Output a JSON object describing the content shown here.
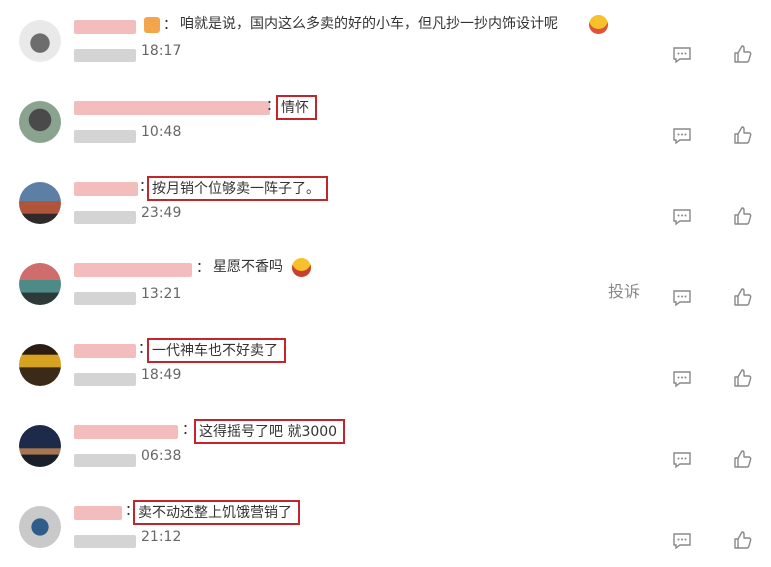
{
  "comments": [
    {
      "text": "咱就是说，国内这么多卖的好的小车，但凡抄一抄内饰设计呢",
      "time": "18:17",
      "boxed": false
    },
    {
      "text": "情怀",
      "time": "10:48",
      "boxed": true
    },
    {
      "text": "按月销个位够卖一阵子了。",
      "time": "23:49",
      "boxed": true
    },
    {
      "text": "星愿不香吗",
      "time": "13:21",
      "boxed": false
    },
    {
      "text": "一代神车也不好卖了",
      "time": "18:49",
      "boxed": true
    },
    {
      "text": "这得摇号了吧 就3000",
      "time": "06:38",
      "boxed": true
    },
    {
      "text": "卖不动还整上饥饿营销了",
      "time": "21:12",
      "boxed": true
    }
  ],
  "report_label": "投诉",
  "separator": "：",
  "icons": {
    "reply": "comment-reply-icon",
    "like": "thumbs-up-icon"
  },
  "colors": {
    "highlight_box": "#c0272d",
    "username_blur": "#f2b1b1"
  }
}
